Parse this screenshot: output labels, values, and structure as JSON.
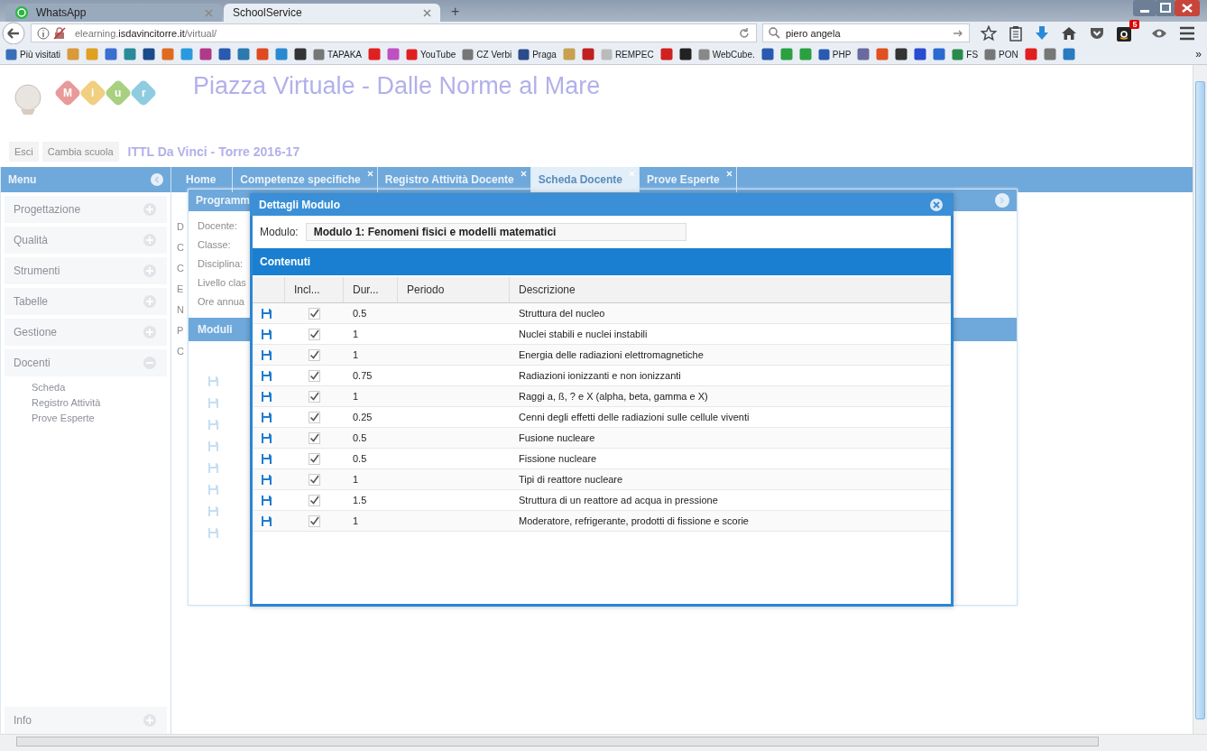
{
  "browser": {
    "tabs": [
      {
        "title": "WhatsApp",
        "kind": "whatsapp",
        "selected": false
      },
      {
        "title": "SchoolService",
        "kind": "plain",
        "selected": true
      }
    ],
    "new_tab": "+",
    "url": {
      "prefix": "elearning.",
      "host": "isdavincitorre.it",
      "path": "/virtual/"
    },
    "search": {
      "value": "piero angela"
    },
    "amazon_badge": "5",
    "bookmarks": [
      {
        "label": "Più visitati",
        "color": "#3a6fb8"
      },
      {
        "color": "#d89a3a"
      },
      {
        "color": "#e0a020"
      },
      {
        "color": "#3a6fd0"
      },
      {
        "color": "#2a8a9a"
      },
      {
        "color": "#1a4a8a"
      },
      {
        "color": "#e06a20"
      },
      {
        "color": "#2a9ae0"
      },
      {
        "color": "#b03a8a"
      },
      {
        "color": "#2a5ab0"
      },
      {
        "color": "#2a7ab0"
      },
      {
        "color": "#e04a20"
      },
      {
        "color": "#2a8ad0"
      },
      {
        "color": "#333333"
      },
      {
        "label": "TAPAKA",
        "color": "#777777"
      },
      {
        "color": "#e02020"
      },
      {
        "color": "#c050c0"
      },
      {
        "label": "YouTube",
        "color": "#e02020"
      },
      {
        "label": "CZ Verbi",
        "color": "#777777"
      },
      {
        "label": "Praga",
        "color": "#2a4a8a"
      },
      {
        "color": "#c8a050"
      },
      {
        "color": "#c02020"
      },
      {
        "label": "REMPEC",
        "color": "#bbbbbb"
      },
      {
        "color": "#d02020"
      },
      {
        "color": "#222222"
      },
      {
        "label": "WebCube.",
        "color": "#888888"
      },
      {
        "color": "#2a5ab0"
      },
      {
        "color": "#2aa040"
      },
      {
        "color": "#2aa040"
      },
      {
        "label": "PHP",
        "color": "#2a5ab0"
      },
      {
        "color": "#6a6aa0"
      },
      {
        "color": "#e05020"
      },
      {
        "color": "#333333"
      },
      {
        "color": "#2a4ad0"
      },
      {
        "color": "#2a6ad0"
      },
      {
        "label": "FS",
        "color": "#2a8a4a"
      },
      {
        "label": "PON",
        "color": "#777777"
      },
      {
        "color": "#e02020"
      },
      {
        "color": "#777777"
      },
      {
        "color": "#2a7ac0"
      }
    ],
    "more": "»"
  },
  "header": {
    "logo_letters": [
      "M",
      "i",
      "u",
      "r"
    ],
    "title": "Piazza Virtuale - Dalle Norme al Mare",
    "buttons": [
      "Esci",
      "Cambia scuola"
    ],
    "school": "ITTL Da Vinci - Torre 2016-17"
  },
  "sidebar": {
    "title": "Menu",
    "sections": [
      {
        "label": "Progettazione",
        "expanded": false
      },
      {
        "label": "Qualità",
        "expanded": false
      },
      {
        "label": "Strumenti",
        "expanded": false
      },
      {
        "label": "Tabelle",
        "expanded": false
      },
      {
        "label": "Gestione",
        "expanded": false
      },
      {
        "label": "Docenti",
        "expanded": true,
        "children": [
          "Scheda",
          "Registro Attività",
          "Prove Esperte"
        ]
      }
    ],
    "footer": {
      "label": "Info",
      "expanded": false
    }
  },
  "page_tabs": [
    {
      "label": "Home",
      "closable": false,
      "selected": false
    },
    {
      "label": "Competenze specifiche",
      "closable": true,
      "selected": false
    },
    {
      "label": "Registro Attività Docente",
      "closable": true,
      "selected": false
    },
    {
      "label": "Scheda Docente",
      "closable": true,
      "selected": true
    },
    {
      "label": "Prove Esperte",
      "closable": true,
      "selected": false
    }
  ],
  "background_fragments": [
    "D",
    "C",
    "C",
    "E",
    "N",
    "P",
    "C"
  ],
  "background_panel": {
    "title": "Programm",
    "labels": [
      "Docente:",
      "Classe:",
      "Disciplina:",
      "Livello clas",
      "Ore annua"
    ],
    "section": "Moduli"
  },
  "dialog": {
    "title": "Dettagli Modulo",
    "module_label": "Modulo:",
    "module_value": "Modulo 1: Fenomeni fisici e modelli matematici",
    "section": "Contenuti",
    "columns": [
      "Incl...",
      "Dur...",
      "Periodo",
      "Descrizione"
    ],
    "rows": [
      {
        "included": true,
        "duration": "0.5",
        "description": "Struttura del nucleo"
      },
      {
        "included": true,
        "duration": "1",
        "description": "Nuclei stabili e nuclei instabili"
      },
      {
        "included": true,
        "duration": "1",
        "description": "Energia delle radiazioni elettromagnetiche"
      },
      {
        "included": true,
        "duration": "0.75",
        "description": "Radiazioni ionizzanti e non ionizzanti"
      },
      {
        "included": true,
        "duration": "1",
        "description": "Raggi a, ß, ? e X (alpha, beta, gamma e X)"
      },
      {
        "included": true,
        "duration": "0.25",
        "description": "Cenni degli effetti delle radiazioni sulle cellule viventi"
      },
      {
        "included": true,
        "duration": "0.5",
        "description": "Fusione nucleare"
      },
      {
        "included": true,
        "duration": "0.5",
        "description": "Fissione nucleare"
      },
      {
        "included": true,
        "duration": "1",
        "description": "Tipi di reattore nucleare"
      },
      {
        "included": true,
        "duration": "1.5",
        "description": "Struttura di un reattore ad acqua in pressione"
      },
      {
        "included": true,
        "duration": "1",
        "description": "Moderatore, refrigerante, prodotti di fissione e scorie"
      }
    ]
  }
}
